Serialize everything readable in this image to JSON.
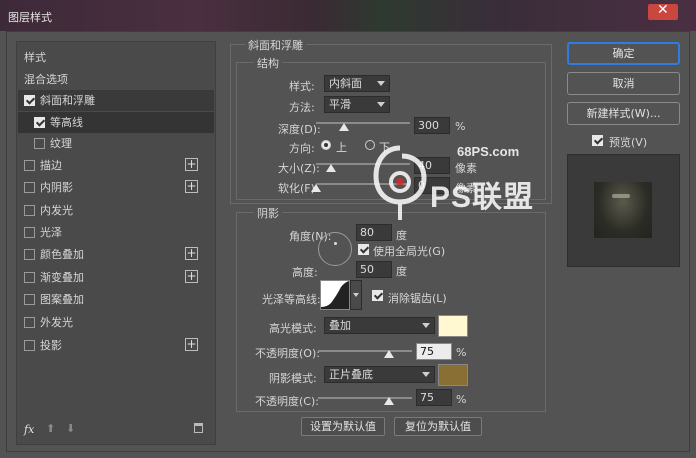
{
  "window": {
    "title": "图层样式"
  },
  "styles_list": [
    {
      "label": "样式",
      "checkbox": false,
      "checked": false,
      "plus": false,
      "selected": false,
      "sub": false
    },
    {
      "label": "混合选项",
      "checkbox": false,
      "checked": false,
      "plus": false,
      "selected": false,
      "sub": false
    },
    {
      "label": "斜面和浮雕",
      "checkbox": true,
      "checked": true,
      "plus": false,
      "selected": true,
      "sub": false
    },
    {
      "label": "等高线",
      "checkbox": true,
      "checked": true,
      "plus": false,
      "selected": true,
      "sub": true
    },
    {
      "label": "纹理",
      "checkbox": true,
      "checked": false,
      "plus": false,
      "selected": false,
      "sub": true
    },
    {
      "label": "描边",
      "checkbox": true,
      "checked": false,
      "plus": true,
      "selected": false,
      "sub": false
    },
    {
      "label": "内阴影",
      "checkbox": true,
      "checked": false,
      "plus": true,
      "selected": false,
      "sub": false
    },
    {
      "label": "内发光",
      "checkbox": true,
      "checked": false,
      "plus": false,
      "selected": false,
      "sub": false
    },
    {
      "label": "光泽",
      "checkbox": true,
      "checked": false,
      "plus": false,
      "selected": false,
      "sub": false
    },
    {
      "label": "颜色叠加",
      "checkbox": true,
      "checked": false,
      "plus": true,
      "selected": false,
      "sub": false
    },
    {
      "label": "渐变叠加",
      "checkbox": true,
      "checked": false,
      "plus": true,
      "selected": false,
      "sub": false
    },
    {
      "label": "图案叠加",
      "checkbox": true,
      "checked": false,
      "plus": false,
      "selected": false,
      "sub": false
    },
    {
      "label": "外发光",
      "checkbox": true,
      "checked": false,
      "plus": false,
      "selected": false,
      "sub": false
    },
    {
      "label": "投影",
      "checkbox": true,
      "checked": false,
      "plus": true,
      "selected": false,
      "sub": false
    }
  ],
  "bevel": {
    "section_title": "斜面和浮雕",
    "structure_title": "结构",
    "style_label": "样式:",
    "style_value": "内斜面",
    "method_label": "方法:",
    "method_value": "平滑",
    "depth_label": "深度(D):",
    "depth_value": "300",
    "depth_unit": "%",
    "depth_level": 0.3,
    "direction_label": "方向:",
    "dir_up": "上",
    "dir_down": "下",
    "size_label": "大小(Z):",
    "size_value": "40",
    "size_unit": "像素",
    "size_level": 0.16,
    "soften_label": "软化(F):",
    "soften_value": "0",
    "soften_unit": "像素",
    "soften_level": 0.0
  },
  "shading": {
    "title": "阴影",
    "angle_label": "角度(N):",
    "angle_value": "80",
    "angle_unit": "度",
    "global_light_label": "使用全局光(G)",
    "altitude_label": "高度:",
    "altitude_value": "50",
    "altitude_unit": "度",
    "gloss_label": "光泽等高线:",
    "antialias_label": "消除锯齿(L)",
    "highlight_label": "高光模式:",
    "highlight_value": "叠加",
    "highlight_color": "#fff8d0",
    "hl_opacity_label": "不透明度(O):",
    "hl_opacity_value": "75",
    "hl_opacity_unit": "%",
    "hl_opacity_level": 0.75,
    "shadow_label": "阴影模式:",
    "shadow_value": "正片叠底",
    "shadow_color": "#8a6f35",
    "sh_opacity_label": "不透明度(C):",
    "sh_opacity_value": "75",
    "sh_opacity_unit": "%",
    "sh_opacity_level": 0.75
  },
  "defaults": {
    "set_label": "设置为默认值",
    "reset_label": "复位为默认值"
  },
  "side_buttons": {
    "ok": "确定",
    "cancel": "取消",
    "new_style": "新建样式(W)...",
    "preview": "预览(V)"
  },
  "footer": {
    "fx": "fx"
  },
  "watermark": {
    "domain": "68PS.com",
    "logo_text": "PS联盟"
  }
}
